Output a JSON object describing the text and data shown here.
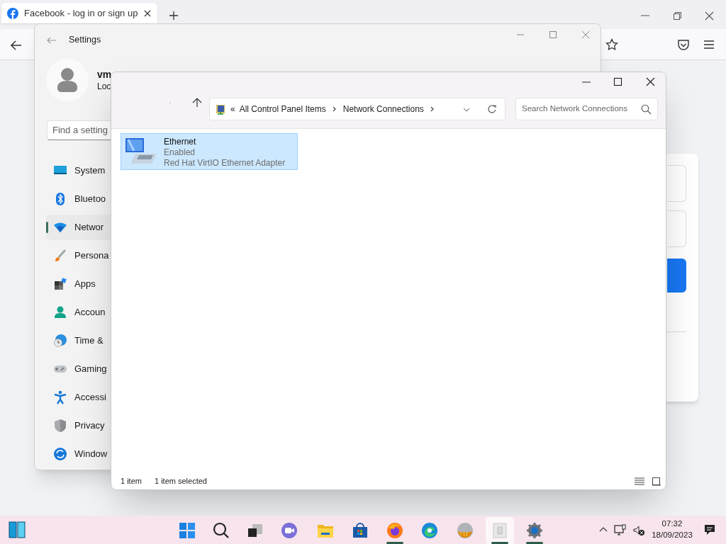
{
  "browser": {
    "tab": {
      "title": "Facebook - log in or sign up",
      "selected": true
    }
  },
  "settings": {
    "window_title": "Settings",
    "user_name": "vm",
    "account_type": "Loc",
    "search": {
      "placeholder": "Find a setting"
    },
    "nav": [
      {
        "label": "System",
        "selected": false
      },
      {
        "label": "Bluetoo",
        "selected": false
      },
      {
        "label": "Networ",
        "selected": true
      },
      {
        "label": "Persona",
        "selected": false
      },
      {
        "label": "Apps",
        "selected": false
      },
      {
        "label": "Accoun",
        "selected": false
      },
      {
        "label": "Time &",
        "selected": false
      },
      {
        "label": "Gaming",
        "selected": false
      },
      {
        "label": "Accessi",
        "selected": false
      },
      {
        "label": "Privacy",
        "selected": false
      },
      {
        "label": "Window",
        "selected": false
      }
    ]
  },
  "explorer": {
    "address": {
      "overflow": "«",
      "crumbs": [
        "All Control Panel Items",
        "Network Connections"
      ]
    },
    "search": {
      "placeholder": "Search Network Connections"
    },
    "items": [
      {
        "name": "Ethernet",
        "status": "Enabled",
        "device": "Red Hat VirtIO Ethernet Adapter",
        "selected": true
      }
    ],
    "status_bar": {
      "count": "1 item",
      "selection": "1 item selected"
    }
  },
  "taskbar": {
    "apps": [
      {
        "running": false,
        "active": false
      },
      {
        "running": false,
        "active": false
      },
      {
        "running": false,
        "active": false
      },
      {
        "running": false,
        "active": false
      },
      {
        "running": false,
        "active": false
      },
      {
        "running": true,
        "active": false
      },
      {
        "running": false,
        "active": false
      },
      {
        "running": false,
        "active": false
      },
      {
        "running": true,
        "active": true
      },
      {
        "running": true,
        "active": false
      }
    ],
    "clock": {
      "time": "07:32",
      "date": "18/09/2023"
    }
  }
}
